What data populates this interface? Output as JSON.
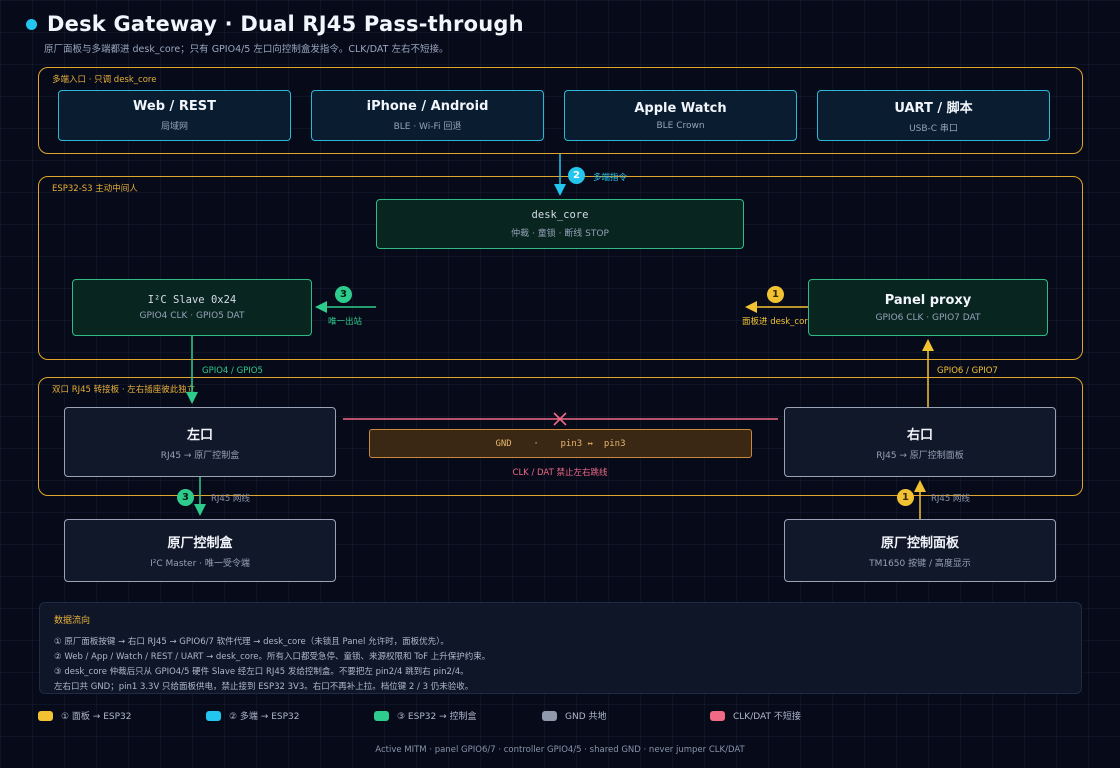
{
  "header": {
    "title": "Desk Gateway · Dual RJ45 Pass-through",
    "subtitle": "原厂面板与多端都进 desk_core；只有 GPIO4/5 左口向控制盒发指令。CLK/DAT 左右不短接。"
  },
  "zones": {
    "inputs": "多端入口 · 只调 desk_core",
    "esp32": "ESP32-S3 主动中间人",
    "adapter": "双口 RJ45 转接板 · 左右插座彼此独立"
  },
  "inputs": [
    {
      "title": "Web / REST",
      "sub": "局域网"
    },
    {
      "title": "iPhone / Android",
      "sub": "BLE · Wi-Fi 回退"
    },
    {
      "title": "Apple Watch",
      "sub": "BLE Crown"
    },
    {
      "title": "UART / 脚本",
      "sub": "USB-C 串口"
    }
  ],
  "desk_core": {
    "title": "desk_core",
    "sub": "仲裁 · 童锁 · 断线 STOP"
  },
  "i2c_slave": {
    "title": "I²C Slave 0x24",
    "sub": "GPIO4 CLK · GPIO5 DAT"
  },
  "panel_proxy": {
    "title": "Panel proxy",
    "sub": "GPIO6 CLK · GPIO7 DAT"
  },
  "left_port": {
    "title": "左口",
    "sub": "RJ45 → 原厂控制盒"
  },
  "right_port": {
    "title": "右口",
    "sub": "RJ45 → 原厂控制面板"
  },
  "gnd_bar": "GND    ·    pin3 ↔  pin3",
  "no_short_label": "CLK / DAT 禁止左右跳线",
  "controller": {
    "title": "原厂控制盒",
    "sub": "I²C Master · 唯一受令端"
  },
  "panel": {
    "title": "原厂控制面板",
    "sub": "TM1650 按键 / 高度显示"
  },
  "wires": {
    "multi_cmd": "多端指令",
    "badge_multi": "2",
    "only_exit": "唯一出站",
    "badge_exit": "3",
    "panel_in": "面板进 desk_core",
    "badge_panel_in": "1",
    "gpio45": "GPIO4 / GPIO5",
    "gpio67": "GPIO6 / GPIO7",
    "rj45_left": "RJ45 网线",
    "badge_left": "3",
    "rj45_right": "RJ45 网线",
    "badge_right": "1"
  },
  "flow": {
    "title": "数据流向",
    "lines": [
      "① 原厂面板按键 → 右口 RJ45 → GPIO6/7 软件代理 → desk_core（未锁且 Panel 允许时，面板优先）。",
      "② Web / App / Watch / REST / UART → desk_core。所有入口都受急停、童锁、来源权限和 ToF 上升保护约束。",
      "③ desk_core 仲裁后只从 GPIO4/5 硬件 Slave 经左口 RJ45 发给控制盒。不要把左 pin2/4 跳到右 pin2/4。",
      "左右口共 GND；pin1 3.3V 只给面板供电，禁止接到 ESP32 3V3。右口不再补上拉。档位键 2 / 3 仍未验收。"
    ]
  },
  "legend": [
    {
      "label": "① 面板 → ESP32",
      "color": "#f2c233"
    },
    {
      "label": "② 多端 → ESP32",
      "color": "#22c6ee"
    },
    {
      "label": "③ ESP32 → 控制盒",
      "color": "#2ecc8c"
    },
    {
      "label": "GND 共地",
      "color": "#8f99ab"
    },
    {
      "label": "CLK/DAT 不短接",
      "color": "#f06a85"
    }
  ],
  "footer": "Active MITM · panel GPIO6/7 · controller GPIO4/5 · shared GND · never jumper CLK/DAT",
  "colors": {
    "zone": "#e0a52a",
    "cyan": "#22c6ee",
    "green": "#2ecc8c",
    "yellow": "#f2c233",
    "red": "#f06a85"
  }
}
